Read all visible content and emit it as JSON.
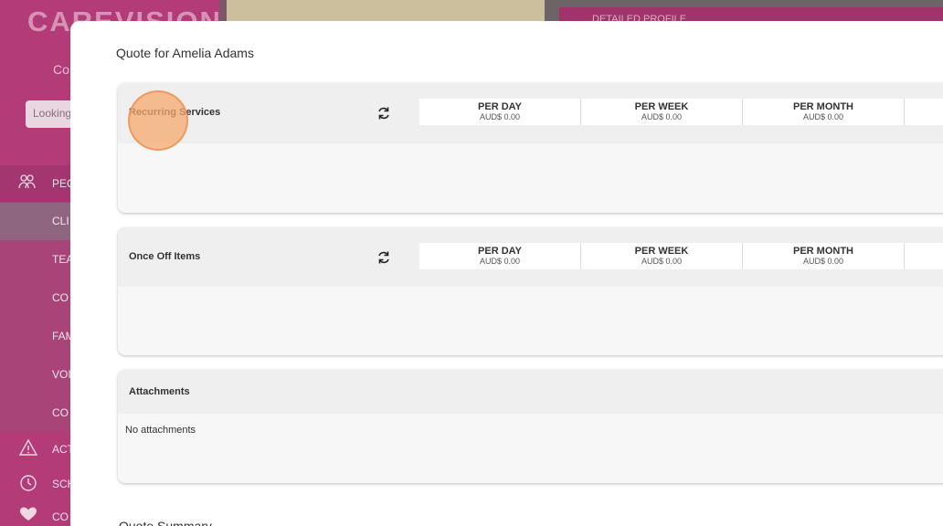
{
  "background": {
    "sidebar": {
      "logo": "CAREVISION",
      "co_text": "Co",
      "search_placeholder": "Looking",
      "items": [
        {
          "label": "PEC",
          "icon": "people-icon"
        },
        {
          "label": "CLI"
        },
        {
          "label": "TEA"
        },
        {
          "label": "CO"
        },
        {
          "label": "FAM"
        },
        {
          "label": "VOI"
        },
        {
          "label": "CO"
        },
        {
          "label": "ACT",
          "icon": "warning-icon"
        },
        {
          "label": "SCH",
          "icon": "clock-icon"
        },
        {
          "label": "CO",
          "icon": "heart-icon"
        }
      ]
    },
    "profile_header": "DETAILED PROFILE"
  },
  "modal": {
    "title": "Quote for Amelia Adams",
    "summary_title": "Quote Summary",
    "sections": [
      {
        "label": "Recurring Services",
        "totals": [
          {
            "label": "PER DAY",
            "value": "AUD$ 0.00"
          },
          {
            "label": "PER WEEK",
            "value": "AUD$ 0.00"
          },
          {
            "label": "PER MONTH",
            "value": "AUD$ 0.00"
          }
        ]
      },
      {
        "label": "Once Off Items",
        "totals": [
          {
            "label": "PER DAY",
            "value": "AUD$ 0.00"
          },
          {
            "label": "PER WEEK",
            "value": "AUD$ 0.00"
          },
          {
            "label": "PER MONTH",
            "value": "AUD$ 0.00"
          }
        ]
      }
    ],
    "attachments": {
      "label": "Attachments",
      "empty_text": "No attachments"
    }
  },
  "colors": {
    "sidebar": "#b23b78",
    "overlay": "#6e3b54",
    "cursor_highlight": "#f6aa6e"
  }
}
